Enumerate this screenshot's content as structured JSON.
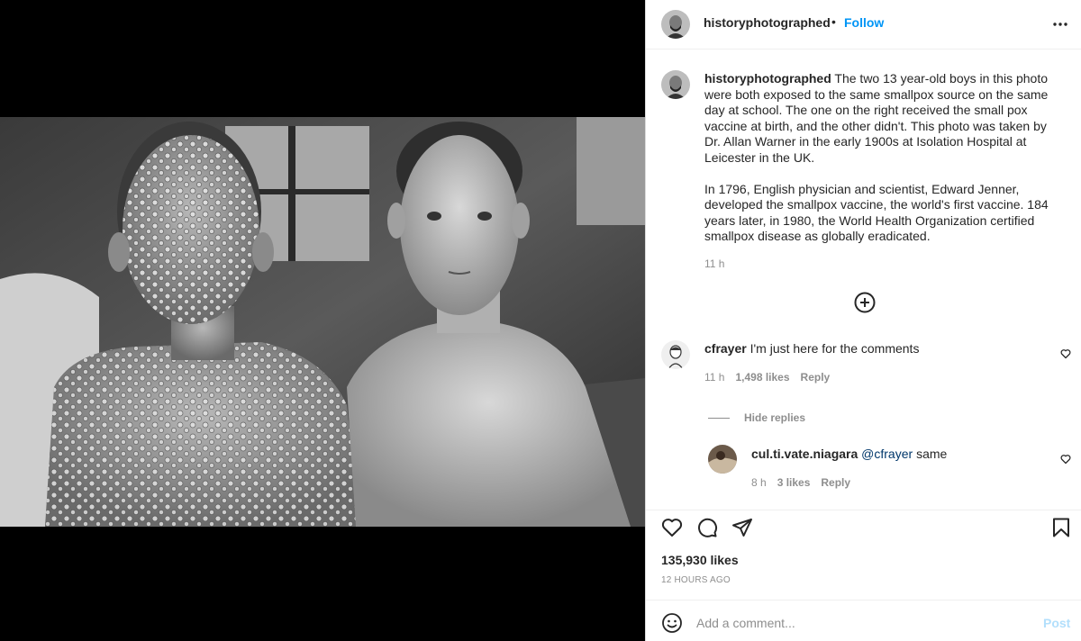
{
  "post": {
    "author": "historyphotographed",
    "follow_label": "Follow",
    "separator": "•",
    "caption_paragraphs": [
      "The two 13 year-old boys in this photo were both exposed to the same smallpox source on the same day at school. The one on the right received the small pox vaccine at birth, and the other didn't. This photo was taken by Dr. Allan Warner in the early 1900s at Isolation Hospital at Leicester in the UK.",
      "In 1796, English physician and scientist, Edward Jenner, developed the smallpox vaccine, the world's first vaccine. 184 years later, in 1980, the World Health Organization certified smallpox disease as globally eradicated."
    ],
    "caption_time": "11 h",
    "likes": "135,930 likes",
    "time_ago": "12 HOURS AGO"
  },
  "comments": [
    {
      "user": "cfrayer",
      "text": "I'm just here for the comments",
      "time": "11 h",
      "likes": "1,498 likes",
      "reply_label": "Reply"
    }
  ],
  "hide_replies_label": "Hide replies",
  "replies": [
    {
      "user": "cul.ti.vate.niagara",
      "mention": "@cfrayer",
      "text": "same",
      "time": "8 h",
      "likes": "3 likes",
      "reply_label": "Reply"
    }
  ],
  "add_comment": {
    "placeholder": "Add a comment...",
    "post_label": "Post"
  },
  "icons": {
    "more": "more-horizontal-icon",
    "load_more": "plus-circle-icon",
    "like": "heart-icon",
    "comment": "comment-bubble-icon",
    "share": "send-icon",
    "save": "bookmark-icon",
    "emoji": "emoji-icon"
  },
  "colors": {
    "accent": "#0095f6",
    "post_disabled": "#b2dffc",
    "secondary_text": "#8e8e8e",
    "mention": "#00376b"
  }
}
